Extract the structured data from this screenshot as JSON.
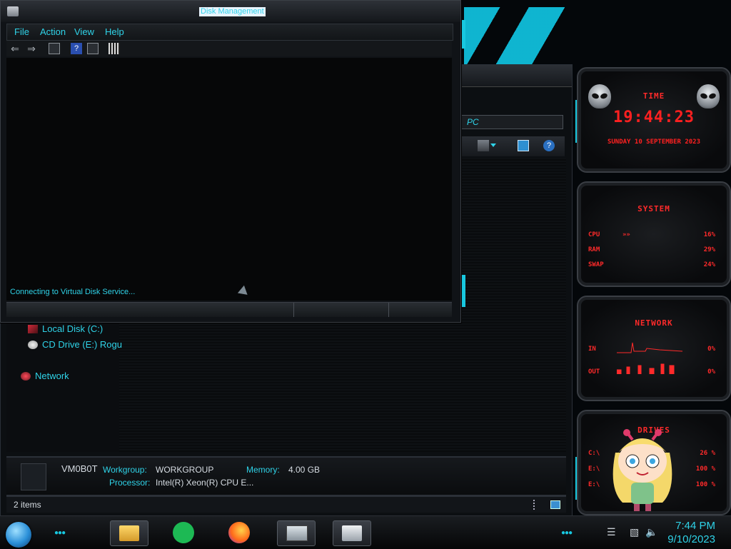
{
  "disk_management": {
    "title": "Disk Management",
    "menu": [
      "File",
      "Action",
      "View",
      "Help"
    ],
    "status": "Connecting to Virtual Disk Service..."
  },
  "explorer": {
    "address_text": "PC",
    "nav": {
      "local_disk": "Local Disk (C:)",
      "cd_drive": "CD Drive (E:) Rogu",
      "network": "Network"
    },
    "details": {
      "computer_name": "VM0B0T",
      "workgroup_label": "Workgroup:",
      "workgroup_value": "WORKGROUP",
      "memory_label": "Memory:",
      "memory_value": "4.00 GB",
      "processor_label": "Processor:",
      "processor_value": "Intel(R) Xeon(R) CPU E..."
    },
    "status_items": "2 items"
  },
  "widgets": {
    "time": {
      "title": "TIME",
      "clock": "19:44:23",
      "date": "SUNDAY 10 SEPTEMBER 2023"
    },
    "system": {
      "title": "SYSTEM",
      "rows": [
        {
          "label": "CPU",
          "value": "16%"
        },
        {
          "label": "RAM",
          "value": "29%"
        },
        {
          "label": "SWAP",
          "value": "24%"
        }
      ]
    },
    "network": {
      "title": "NETWORK",
      "rows": [
        {
          "label": "IN",
          "value": "0%"
        },
        {
          "label": "OUT",
          "value": "0%"
        }
      ]
    },
    "drives": {
      "title": "DRIVES",
      "rows": [
        {
          "label": "C:\\",
          "value": "26 %"
        },
        {
          "label": "E:\\",
          "value": "100 %"
        },
        {
          "label": "E:\\",
          "value": "100 %"
        }
      ]
    },
    "accent": "#ff2a2a"
  },
  "taskbar": {
    "apps": [
      "file-explorer-icon",
      "spotify-icon",
      "firefox-icon",
      "system-monitor-icon",
      "disk-management-icon"
    ],
    "time": "7:44 PM",
    "date": "9/10/2023"
  },
  "colors": {
    "cyan_accent": "#2fd3e8",
    "background": "#04070a"
  }
}
